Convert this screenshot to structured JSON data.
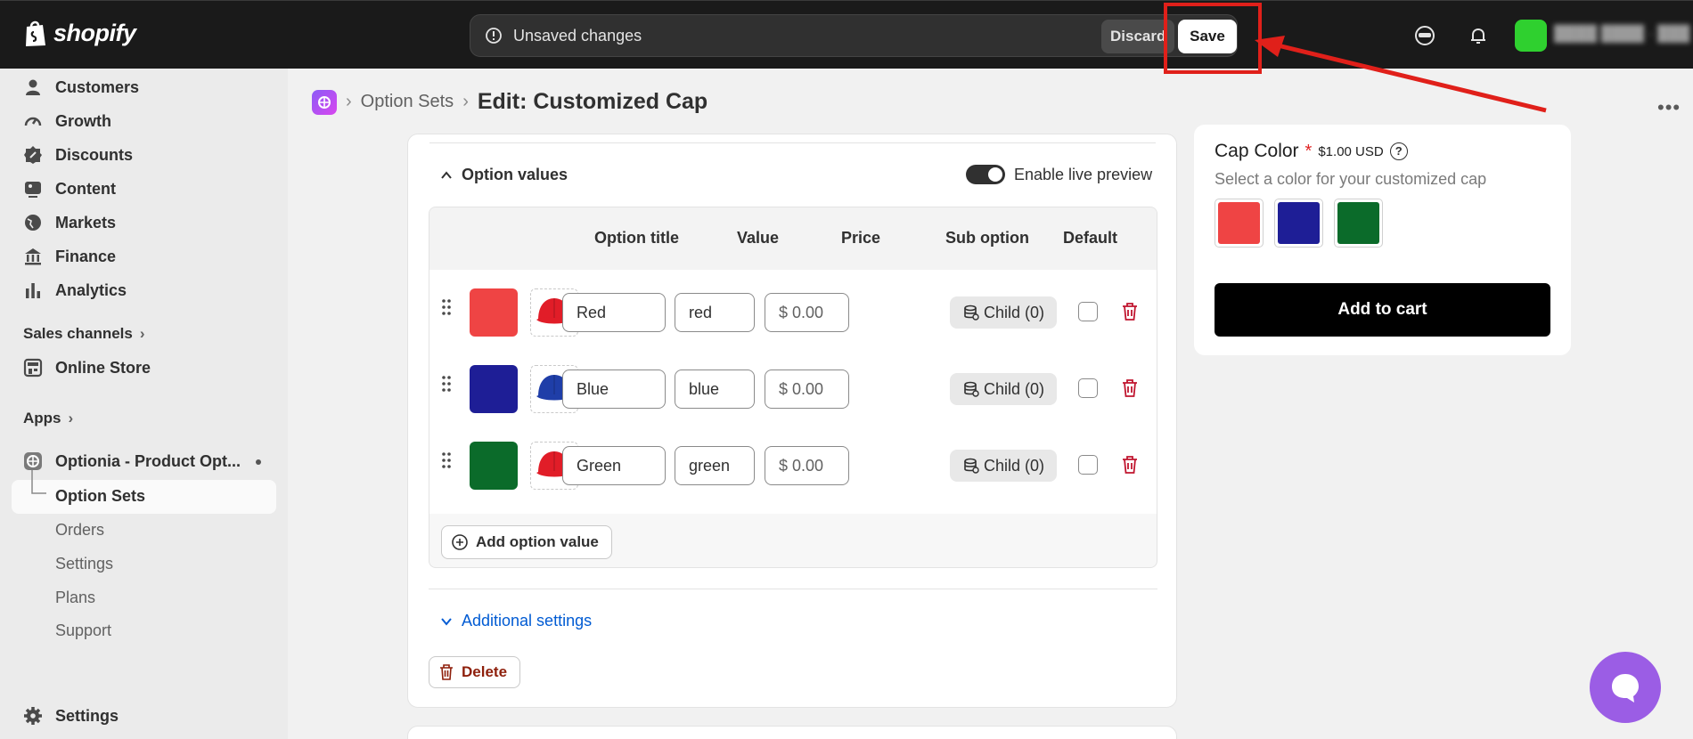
{
  "topbar": {
    "logo_text": "shopify",
    "unsaved_text": "Unsaved changes",
    "discard_label": "Discard",
    "save_label": "Save"
  },
  "sidebar": {
    "items": [
      {
        "label": "Customers",
        "icon": "person-icon"
      },
      {
        "label": "Growth",
        "icon": "gauge-icon"
      },
      {
        "label": "Discounts",
        "icon": "discount-icon"
      },
      {
        "label": "Content",
        "icon": "image-icon"
      },
      {
        "label": "Markets",
        "icon": "globe-icon"
      },
      {
        "label": "Finance",
        "icon": "bank-icon"
      },
      {
        "label": "Analytics",
        "icon": "bar-chart-icon"
      }
    ],
    "sales_channels_label": "Sales channels",
    "online_store_label": "Online Store",
    "apps_label": "Apps",
    "app_name": "Optionia - Product Opt...",
    "app_sub_items": [
      "Option Sets",
      "Orders",
      "Settings",
      "Plans",
      "Support"
    ],
    "settings_label": "Settings"
  },
  "header": {
    "breadcrumb": "Option Sets",
    "title": "Edit: Customized Cap"
  },
  "option_values": {
    "section_title": "Option values",
    "live_preview_label": "Enable live preview",
    "columns": [
      "Option title",
      "Value",
      "Price",
      "Sub option",
      "Default"
    ],
    "rows": [
      {
        "swatch_color": "#ef4444",
        "cap_color": "#e11d28",
        "title": "Red",
        "value": "red",
        "price": "$ 0.00",
        "sub_option": "Child (0)"
      },
      {
        "swatch_color": "#1e1e96",
        "cap_color": "#1f3ea8",
        "title": "Blue",
        "value": "blue",
        "price": "$ 0.00",
        "sub_option": "Child (0)"
      },
      {
        "swatch_color": "#0b6b2a",
        "cap_color": "#e11d28",
        "title": "Green",
        "value": "green",
        "price": "$ 0.00",
        "sub_option": "Child (0)"
      }
    ],
    "add_value_label": "Add option value",
    "additional_settings_label": "Additional settings",
    "delete_label": "Delete"
  },
  "preview": {
    "title": "Cap Color",
    "required_mark": "*",
    "price": "$1.00 USD",
    "help": "?",
    "description": "Select a color for your customized cap",
    "swatches": [
      "#ef4444",
      "#1e1e96",
      "#0b6b2a"
    ],
    "cart_label": "Add to cart"
  },
  "colors": {
    "annotation": "#e0201a",
    "chat": "#9b5de5"
  }
}
